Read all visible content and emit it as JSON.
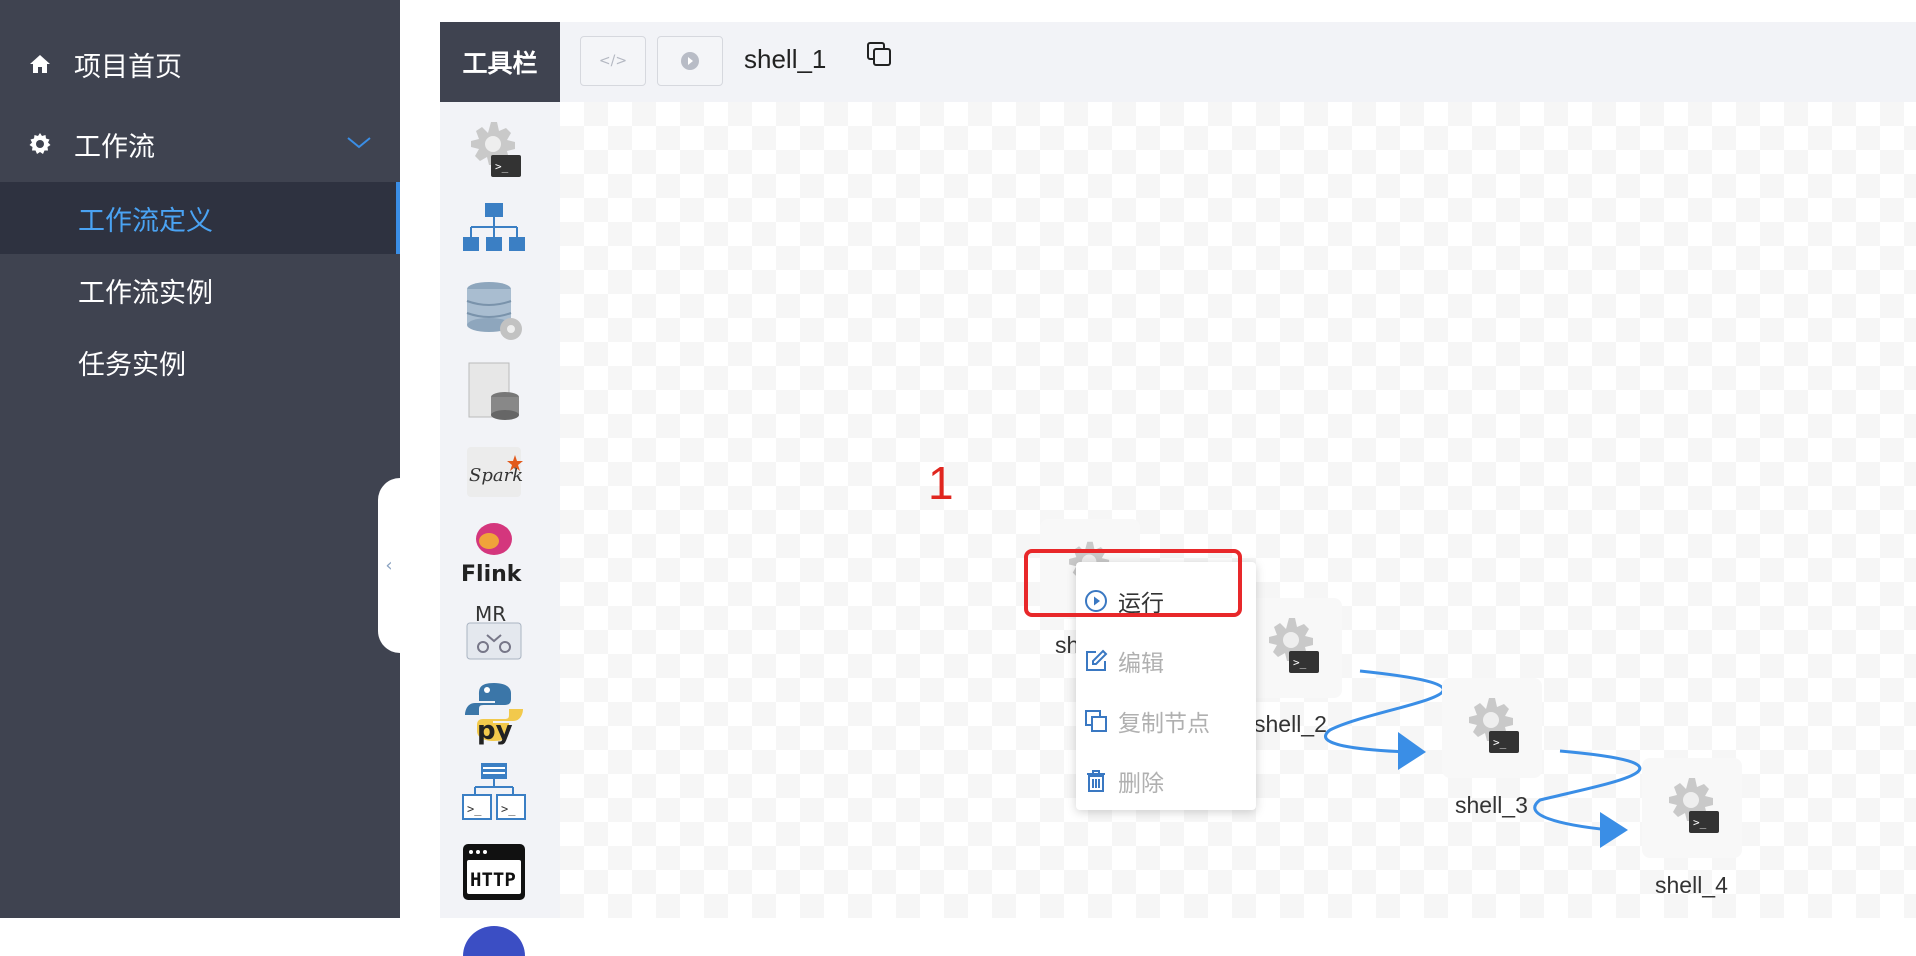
{
  "sidebar": {
    "home": {
      "label": "项目首页",
      "icon": "home-icon"
    },
    "workflow": {
      "label": "工作流",
      "icon": "gear-icon",
      "expanded": true
    },
    "submenu": [
      {
        "label": "工作流定义",
        "active": true
      },
      {
        "label": "工作流实例"
      },
      {
        "label": "任务实例"
      }
    ],
    "collapse_glyph": "‹"
  },
  "toolbar": {
    "toolbox_title": "工具栏",
    "code_glyph": "</>",
    "workflow_name": "shell_1"
  },
  "tools": [
    "shell",
    "sub_process",
    "procedure",
    "sql",
    "spark",
    "flink",
    "mr",
    "python",
    "dependent",
    "http",
    "datax"
  ],
  "tool_labels": {
    "flink": "Flink",
    "mr": "MR",
    "python": "py",
    "http": "HTTP",
    "spark": "Spark"
  },
  "nodes": [
    {
      "label": "sh"
    },
    {
      "label": "shell_2"
    },
    {
      "label": "shell_3"
    },
    {
      "label": "shell_4"
    }
  ],
  "annotation": "1",
  "context_menu": {
    "run": "运行",
    "edit": "编辑",
    "copy": "复制节点",
    "delete": "删除"
  },
  "colors": {
    "sidebar_bg": "#3f4350",
    "active_text": "#4aa3f3",
    "accent": "#3a8ee6",
    "highlight": "#e8282a"
  }
}
